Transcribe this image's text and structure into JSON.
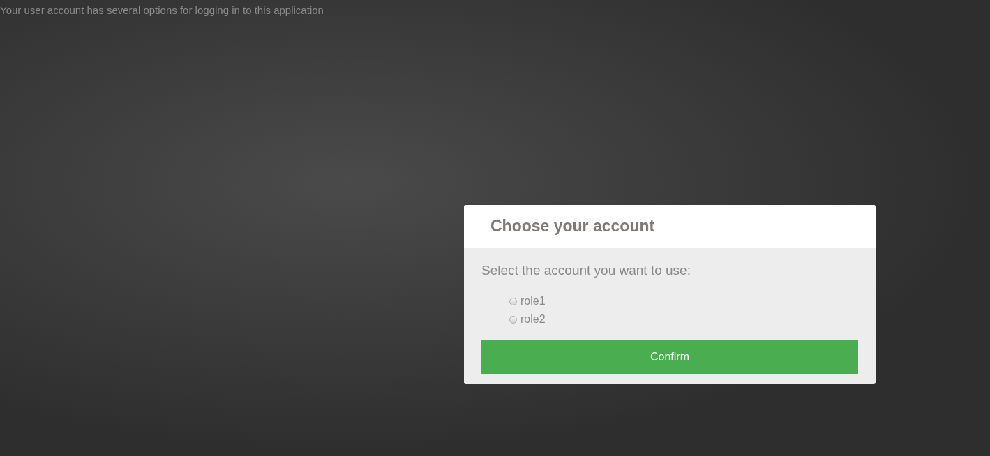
{
  "notice": "Your user account has several options for logging in to this application",
  "dialog": {
    "title": "Choose your account",
    "prompt": "Select the account you want to use:",
    "options": [
      {
        "label": "role1",
        "selected": false
      },
      {
        "label": "role2",
        "selected": false
      }
    ],
    "button": "Confirm"
  }
}
